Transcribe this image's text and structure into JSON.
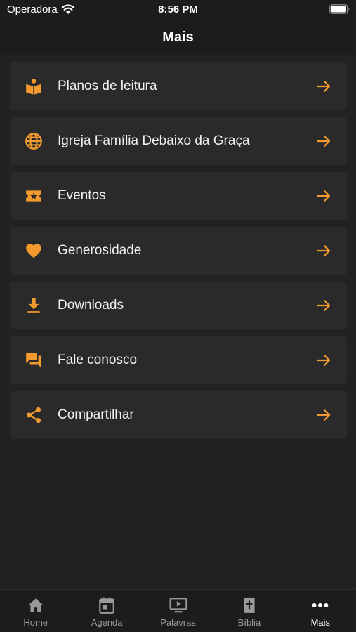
{
  "status_bar": {
    "carrier": "Operadora",
    "time": "8:56 PM"
  },
  "header": {
    "title": "Mais"
  },
  "accent_color": "#f29a2e",
  "menu": {
    "items": [
      {
        "label": "Planos de leitura",
        "icon": "book-reader-icon"
      },
      {
        "label": "Igreja Família Debaixo da Graça",
        "icon": "globe-icon"
      },
      {
        "label": "Eventos",
        "icon": "ticket-star-icon"
      },
      {
        "label": "Generosidade",
        "icon": "heart-icon"
      },
      {
        "label": "Downloads",
        "icon": "download-icon"
      },
      {
        "label": "Fale conosco",
        "icon": "chat-bubbles-icon"
      },
      {
        "label": "Compartilhar",
        "icon": "share-icon"
      }
    ]
  },
  "tab_bar": {
    "active": "Mais",
    "tabs": [
      {
        "label": "Home",
        "icon": "home-icon"
      },
      {
        "label": "Agenda",
        "icon": "calendar-icon"
      },
      {
        "label": "Palavras",
        "icon": "video-play-icon"
      },
      {
        "label": "Bíblia",
        "icon": "bible-icon"
      },
      {
        "label": "Mais",
        "icon": "more-dots-icon"
      }
    ]
  }
}
